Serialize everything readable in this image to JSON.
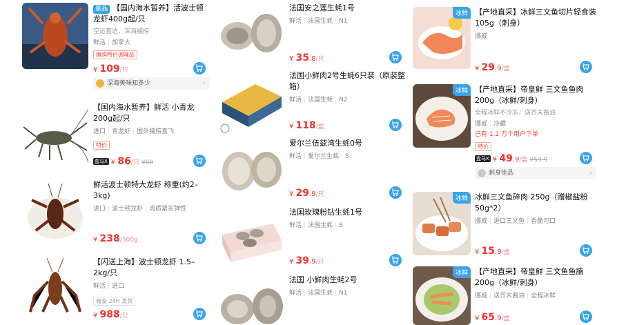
{
  "colors": {
    "accent": "#3aa3e8",
    "price": "#f0332c"
  },
  "col1": [
    {
      "title": "【国内海水暂养】活波士顿龙虾400g起/只",
      "badge": "星品",
      "sub": "空运直达，深海捕捞",
      "meta": [
        "鲜活",
        "加拿大"
      ],
      "promo": "换购特价调味品",
      "price_int": "109",
      "price_dec": "",
      "unit": "/只",
      "old": "",
      "bar": "深海美味知多少"
    },
    {
      "title": "【国内海水暂养】鲜活 小青龙200g起/只",
      "meta": [
        "进口",
        "青龙虾",
        "国外捕捞直飞"
      ],
      "promo": "特价",
      "mini": "盒马X",
      "price_int": "86",
      "price_dec": "",
      "unit": "/只",
      "old": "¥99"
    },
    {
      "title": "鲜活波士顿特大龙虾 称重(约2–3kg)",
      "meta": [
        "进口",
        "波士顿龙虾",
        "肉质紧实弹性"
      ],
      "price_int": "238",
      "price_dec": "",
      "unit": "/500g",
      "old": ""
    },
    {
      "title": "【闪送上海】波士顿龙虾 1.5–2kg/只",
      "meta": [
        "鲜活",
        "进口"
      ],
      "promo": "商家 24H 发货",
      "price_int": "988",
      "price_dec": "",
      "unit": "/只",
      "old": ""
    }
  ],
  "col2": [
    {
      "title": "法国安之莲生蚝1号",
      "meta": [
        "鲜活",
        "法国生蚝",
        "N1"
      ],
      "price_int": "35",
      "price_dec": ".8",
      "unit": "/只"
    },
    {
      "title": "法国小鲜肉2号生蚝6只装（原装整箱）",
      "meta": [
        "鲜活",
        "法国生蚝",
        "N2"
      ],
      "price_int": "118",
      "price_dec": "",
      "unit": "/盒"
    },
    {
      "title": "爱尔兰伍兹湾生蚝0号",
      "meta": [
        "鲜活",
        "爱尔兰生蚝",
        "S"
      ],
      "price_int": "29",
      "price_dec": ".9",
      "unit": "/只"
    },
    {
      "title": "法国玫瑰粉钻生蚝1号",
      "meta": [
        "鲜活",
        "法国生蚝",
        "S"
      ],
      "price_int": "39",
      "price_dec": ".9",
      "unit": "/只"
    },
    {
      "title": "法国 小鲜肉生蚝2号",
      "meta": [
        "鲜活",
        "法国生蚝",
        "N1"
      ],
      "price_int": "",
      "price_dec": "",
      "unit": ""
    }
  ],
  "col3": [
    {
      "title": "【产地直采】冰鲜三文鱼切片轻食装 105g（刺身）",
      "corner": "冰鲜",
      "meta": [
        "挪威"
      ],
      "price_int": "29",
      "price_dec": ".9",
      "unit": "/盒"
    },
    {
      "title": "【产地直采】帝皇鲜 三文鱼鱼肉200g（冰鲜/刺身）",
      "corner": "冰鲜",
      "sub": "全程冰鲜不冷冻，送芥末酱油",
      "meta": [
        "挪威",
        "冷藏"
      ],
      "promo": "已有 1.2 万个用户下单",
      "promo2": "特价",
      "mini": "盒马X",
      "price_int": "49",
      "price_dec": ".9",
      "unit": "/盒",
      "old": "¥59.9",
      "bar": "刺身佳品"
    },
    {
      "title": "冰鲜三文鱼碎肉 250g（赠椒盐粉50g*2）",
      "corner": "冰鲜",
      "meta": [
        "挪威",
        "进口三文鱼",
        "香脆可口"
      ],
      "price_int": "15",
      "price_dec": ".9",
      "unit": "/盒"
    },
    {
      "title": "【产地直采】帝皇鲜 三文鱼鱼腩200g（冰鲜/刺身）",
      "corner": "冰鲜",
      "meta": [
        "挪威",
        "送芥末酱油",
        "全程冰鲜"
      ],
      "price_int": "65",
      "price_dec": ".9",
      "unit": "/盒"
    }
  ]
}
